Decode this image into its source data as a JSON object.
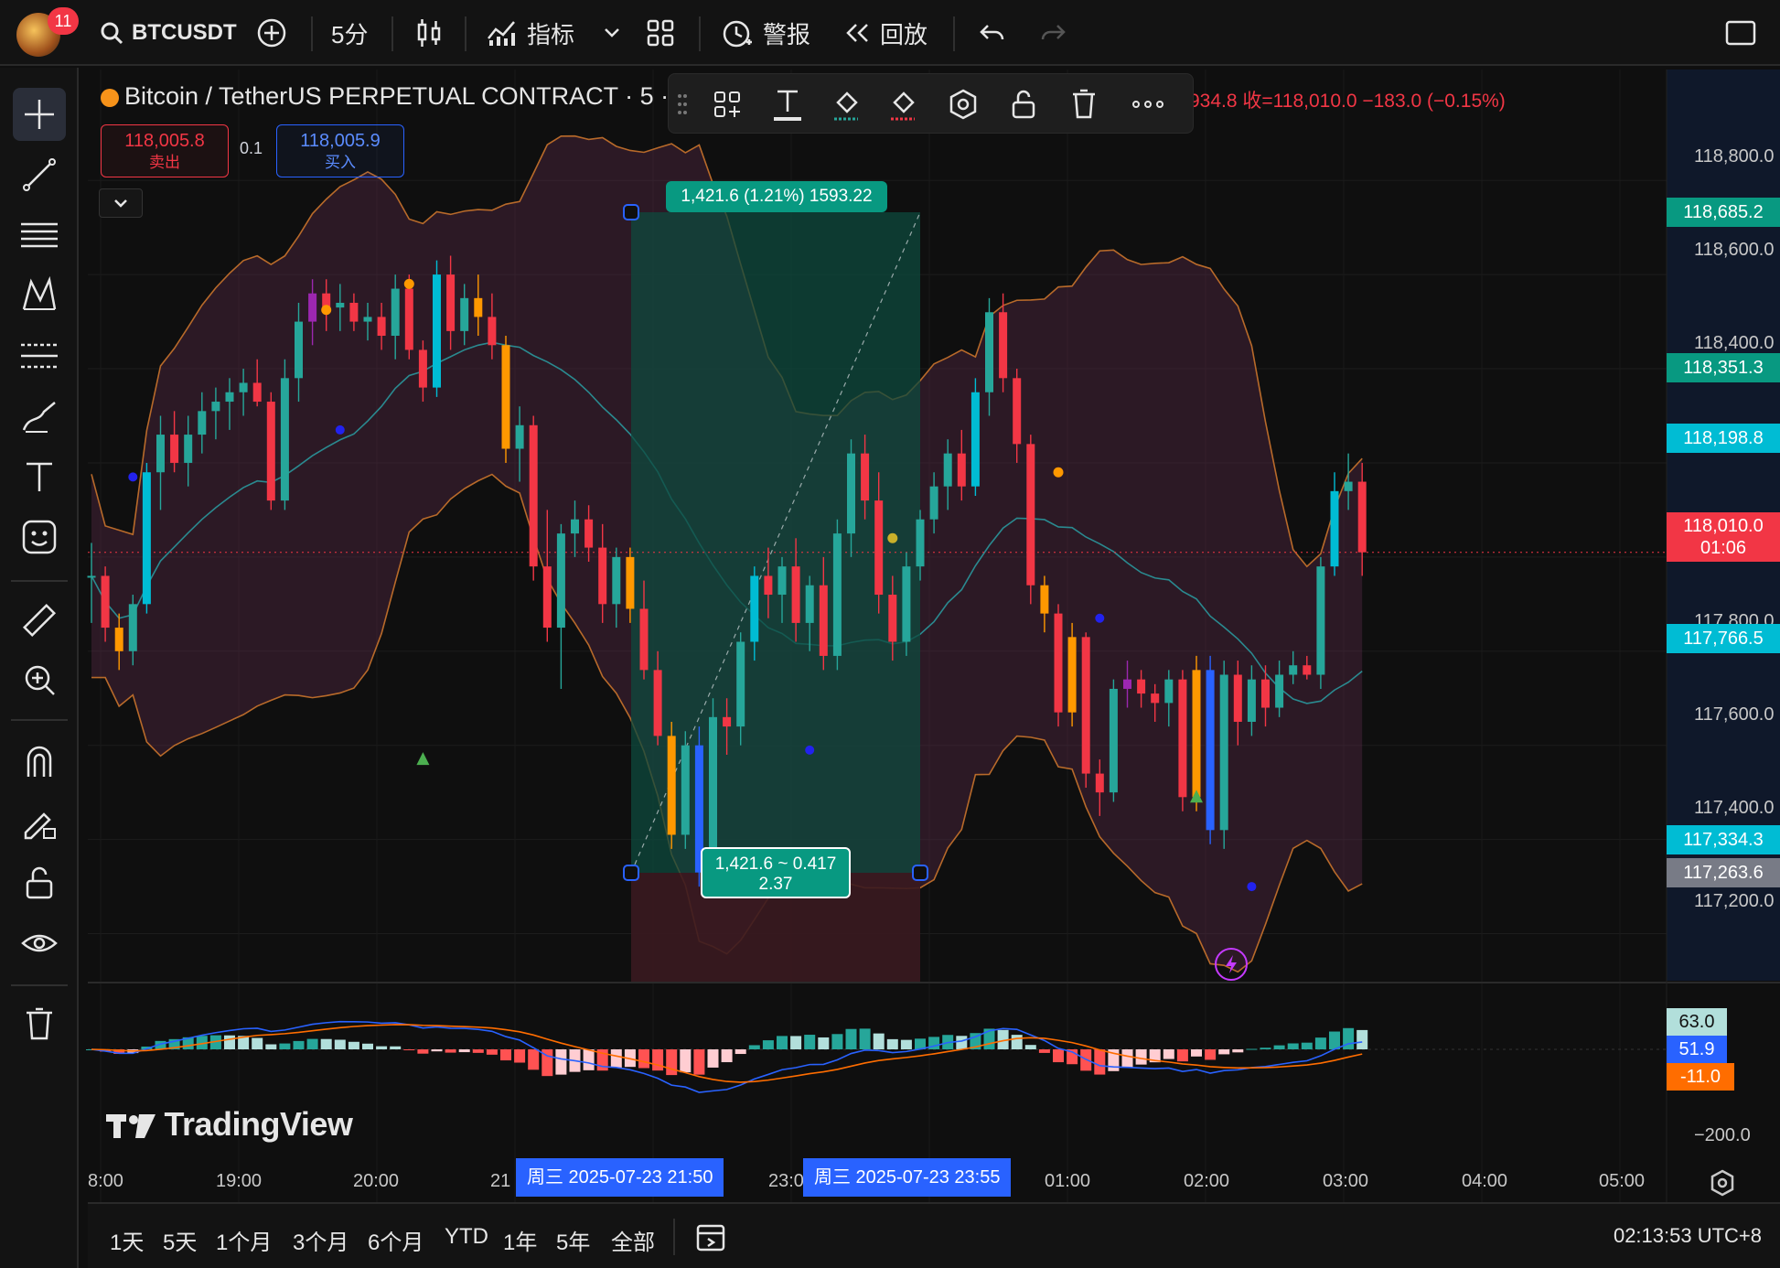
{
  "header": {
    "notification_count": "11",
    "symbol": "BTCUSDT",
    "interval": "5分",
    "indicators_label": "指标",
    "alerts_label": "警报",
    "replay_label": "回放"
  },
  "legend": {
    "title": "Bitcoin / TetherUS PERPETUAL CONTRACT · 5 ·",
    "ohlc_tail": "934.8 收=118,010.0 −183.0 (−0.15%)"
  },
  "order": {
    "sell_price": "118,005.8",
    "sell_label": "卖出",
    "spread": "0.1",
    "buy_price": "118,005.9",
    "buy_label": "买入"
  },
  "measure": {
    "top_label": "1,421.6 (1.21%) 1593.22",
    "bottom_line1": "1,421.6 ~ 0.417",
    "bottom_line2": "2.37"
  },
  "price_axis": {
    "labels": [
      "118,800.0",
      "118,600.0",
      "118,400.0",
      "117,800.0",
      "117,600.0",
      "117,400.0",
      "117,200.0"
    ],
    "tag_upper": "118,685.2",
    "tag_351": "118,351.3",
    "tag_198": "118,198.8",
    "tag_last": "118,010.0",
    "tag_countdown": "01:06",
    "tag_766": "117,766.5",
    "tag_334": "117,334.3",
    "tag_263": "117,263.6"
  },
  "macd_axis": {
    "hist": "63.0",
    "macd": "51.9",
    "signal": "-11.0",
    "low": "−200.0"
  },
  "time_axis": {
    "labels": [
      "8:00",
      "19:00",
      "20:00",
      "21",
      "23:0",
      "01:00",
      "02:00",
      "03:00",
      "04:00",
      "05:00"
    ],
    "tag_start": "周三 2025-07-23   21:50",
    "tag_end": "周三 2025-07-23   23:55"
  },
  "watermark": "TradingView",
  "ranges": [
    "1天",
    "5天",
    "1个月",
    "3个月",
    "6个月",
    "YTD",
    "1年",
    "5年",
    "全部"
  ],
  "clock": "02:13:53 UTC+8",
  "colors": {
    "up": "#26a69a",
    "down": "#f23645",
    "orange": "#ff9800",
    "blue": "#2962ff",
    "cyan": "#00bcd4",
    "purple": "#9c27b0",
    "profit_zone": "#0d4a3e",
    "loss_zone": "#3a1a20"
  },
  "chart_data": {
    "type": "candlestick",
    "price_range": [
      117100,
      118950
    ],
    "candles_ohlc": [
      [
        117960,
        118030,
        117860,
        117960
      ],
      [
        117960,
        117980,
        117820,
        117850
      ],
      [
        117850,
        117880,
        117760,
        117800
      ],
      [
        117800,
        117920,
        117770,
        117900
      ],
      [
        117900,
        118200,
        117880,
        118180
      ],
      [
        118180,
        118300,
        118100,
        118260
      ],
      [
        118260,
        118310,
        118180,
        118200
      ],
      [
        118200,
        118300,
        118150,
        118260
      ],
      [
        118260,
        118350,
        118220,
        118310
      ],
      [
        118310,
        118360,
        118250,
        118330
      ],
      [
        118330,
        118380,
        118270,
        118350
      ],
      [
        118350,
        118400,
        118300,
        118370
      ],
      [
        118370,
        118420,
        118320,
        118330
      ],
      [
        118330,
        118350,
        118100,
        118120
      ],
      [
        118120,
        118420,
        118100,
        118380
      ],
      [
        118380,
        118540,
        118330,
        118500
      ],
      [
        118500,
        118590,
        118450,
        118560
      ],
      [
        118560,
        118590,
        118480,
        118530
      ],
      [
        118530,
        118580,
        118480,
        118540
      ],
      [
        118540,
        118560,
        118480,
        118500
      ],
      [
        118500,
        118540,
        118460,
        118510
      ],
      [
        118510,
        118540,
        118440,
        118470
      ],
      [
        118470,
        118600,
        118420,
        118570
      ],
      [
        118570,
        118600,
        118420,
        118440
      ],
      [
        118440,
        118460,
        118330,
        118360
      ],
      [
        118360,
        118630,
        118340,
        118600
      ],
      [
        118600,
        118640,
        118440,
        118480
      ],
      [
        118480,
        118580,
        118450,
        118550
      ],
      [
        118550,
        118600,
        118470,
        118510
      ],
      [
        118510,
        118560,
        118420,
        118450
      ],
      [
        118450,
        118470,
        118200,
        118230
      ],
      [
        118230,
        118320,
        118160,
        118280
      ],
      [
        118280,
        118300,
        117950,
        117980
      ],
      [
        117980,
        118100,
        117820,
        117850
      ],
      [
        117850,
        118070,
        117720,
        118050
      ],
      [
        118050,
        118120,
        118000,
        118080
      ],
      [
        118080,
        118110,
        117990,
        118020
      ],
      [
        118020,
        118070,
        117860,
        117900
      ],
      [
        117900,
        118020,
        117850,
        118000
      ],
      [
        118000,
        118020,
        117860,
        117890
      ],
      [
        117890,
        117950,
        117740,
        117760
      ],
      [
        117760,
        117800,
        117600,
        117620
      ],
      [
        117620,
        117650,
        117380,
        117410
      ],
      [
        117410,
        117630,
        117380,
        117600
      ],
      [
        117600,
        117640,
        117300,
        117330
      ],
      [
        117330,
        117700,
        117300,
        117660
      ],
      [
        117660,
        117700,
        117580,
        117640
      ],
      [
        117640,
        117840,
        117600,
        117820
      ],
      [
        117820,
        117980,
        117780,
        117960
      ],
      [
        117960,
        118020,
        117870,
        117920
      ],
      [
        117920,
        118000,
        117860,
        117980
      ],
      [
        117980,
        118040,
        117820,
        117860
      ],
      [
        117860,
        117960,
        117800,
        117940
      ],
      [
        117940,
        118000,
        117760,
        117790
      ],
      [
        117790,
        118080,
        117760,
        118050
      ],
      [
        118050,
        118250,
        118000,
        118220
      ],
      [
        118220,
        118260,
        118080,
        118120
      ],
      [
        118120,
        118180,
        117880,
        117920
      ],
      [
        117920,
        117960,
        117780,
        117820
      ],
      [
        117820,
        118010,
        117790,
        117980
      ],
      [
        117980,
        118100,
        117950,
        118080
      ],
      [
        118080,
        118180,
        118050,
        118150
      ],
      [
        118150,
        118250,
        118100,
        118220
      ],
      [
        118220,
        118270,
        118120,
        118150
      ],
      [
        118150,
        118380,
        118130,
        118350
      ],
      [
        118350,
        118550,
        118300,
        118520
      ],
      [
        118520,
        118560,
        118350,
        118380
      ],
      [
        118380,
        118400,
        118200,
        118240
      ],
      [
        118240,
        118260,
        117900,
        117940
      ],
      [
        117940,
        117960,
        117840,
        117880
      ],
      [
        117880,
        117900,
        117640,
        117670
      ],
      [
        117670,
        117860,
        117640,
        117830
      ],
      [
        117830,
        117840,
        117510,
        117540
      ],
      [
        117540,
        117570,
        117450,
        117500
      ],
      [
        117500,
        117740,
        117480,
        117720
      ],
      [
        117720,
        117780,
        117680,
        117740
      ],
      [
        117740,
        117760,
        117680,
        117710
      ],
      [
        117710,
        117730,
        117650,
        117690
      ],
      [
        117690,
        117760,
        117640,
        117740
      ],
      [
        117740,
        117760,
        117460,
        117490
      ],
      [
        117490,
        117790,
        117460,
        117760
      ],
      [
        117760,
        117790,
        117390,
        117420
      ],
      [
        117420,
        117780,
        117380,
        117750
      ],
      [
        117750,
        117780,
        117600,
        117650
      ],
      [
        117650,
        117770,
        117620,
        117740
      ],
      [
        117740,
        117770,
        117640,
        117680
      ],
      [
        117680,
        117780,
        117660,
        117750
      ],
      [
        117750,
        117800,
        117730,
        117770
      ],
      [
        117770,
        117790,
        117740,
        117750
      ],
      [
        117750,
        118000,
        117720,
        117980
      ],
      [
        117980,
        118180,
        117960,
        118140
      ],
      [
        118140,
        118220,
        118100,
        118160
      ],
      [
        118160,
        118200,
        117960,
        118010
      ]
    ]
  }
}
